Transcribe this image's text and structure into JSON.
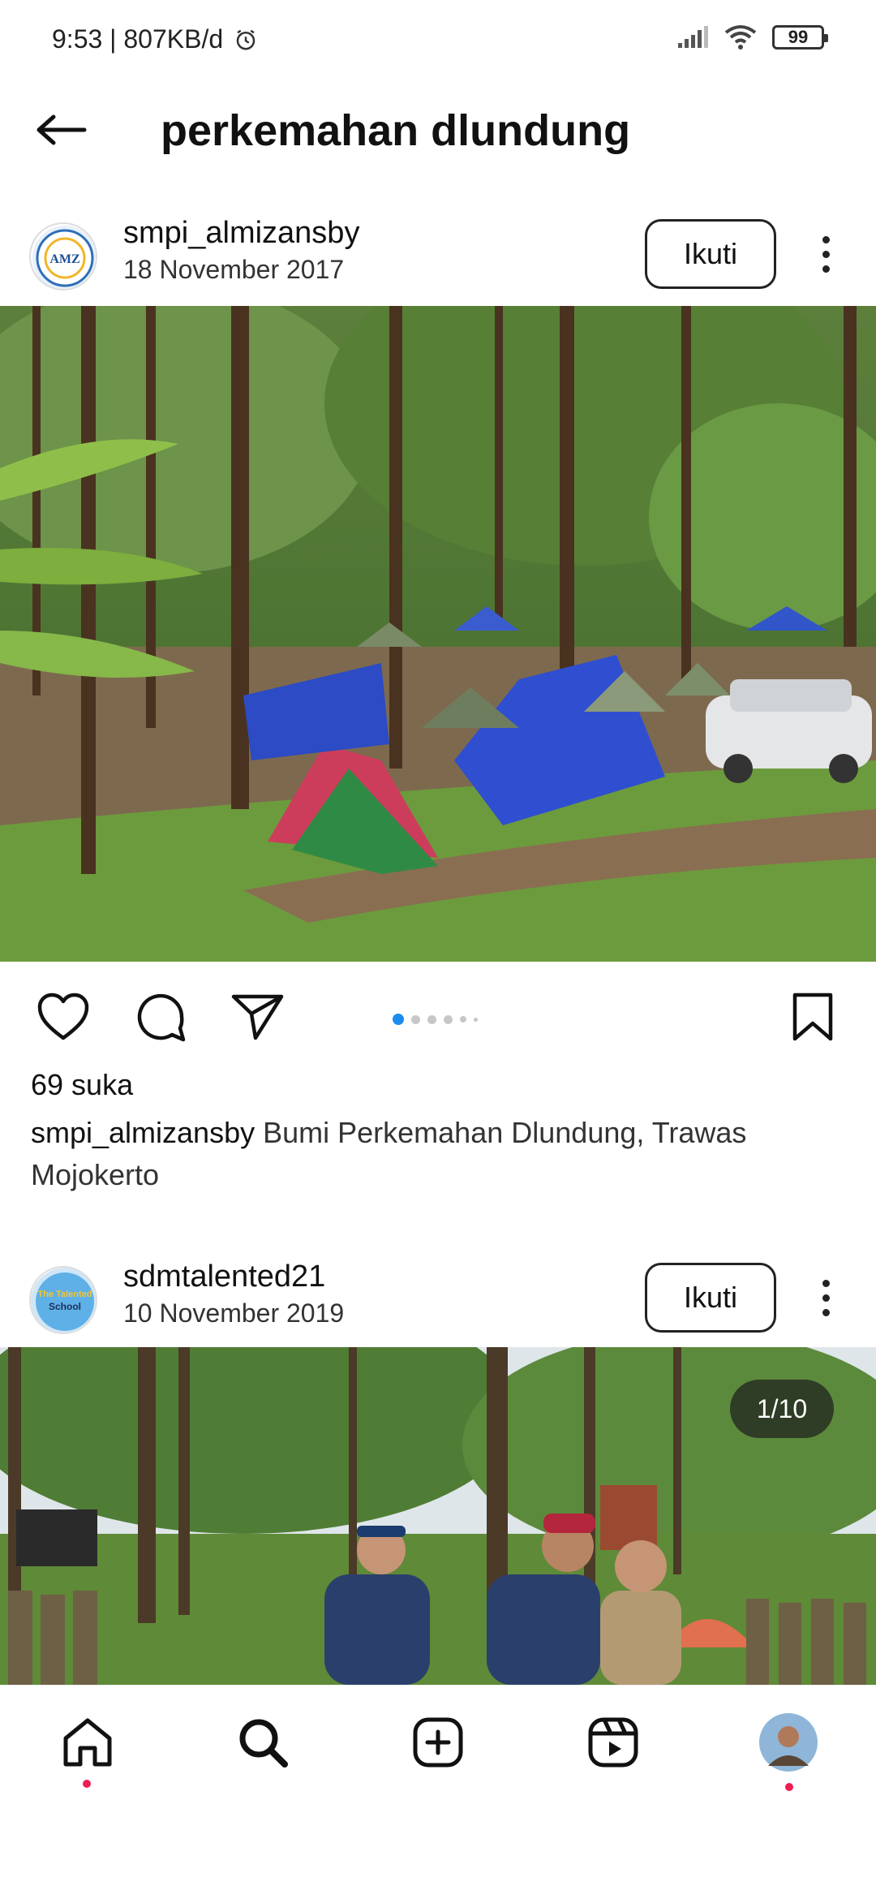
{
  "status_bar": {
    "time": "9:53",
    "network_speed": "807KB/d",
    "battery": "99",
    "icons": [
      "alarm-icon",
      "signal-icon",
      "wifi-icon",
      "battery-icon"
    ]
  },
  "header": {
    "title": "perkemahan dlundung",
    "back_icon": "arrow-left-icon"
  },
  "posts": [
    {
      "username": "smpi_almizansby",
      "date": "18 November 2017",
      "follow_label": "Ikuti",
      "likes": "69 suka",
      "caption_user": "smpi_almizansby",
      "caption_text": " Bumi Perkemahan Dlundung,  Trawas Mojokerto",
      "carousel": {
        "count": 6,
        "active": 0
      }
    },
    {
      "username": "sdmtalented21",
      "date": "10 November 2019",
      "follow_label": "Ikuti",
      "counter": "1/10"
    }
  ],
  "avatars": {
    "post1_logo_text": "AMZ",
    "post2_logo_text": "The Talented School"
  },
  "colors": {
    "accent_blue": "#1a8cf0",
    "notification_red": "#ee1d52"
  },
  "bottom_nav": [
    "home-icon",
    "search-icon",
    "create-icon",
    "reels-icon",
    "profile-avatar"
  ]
}
